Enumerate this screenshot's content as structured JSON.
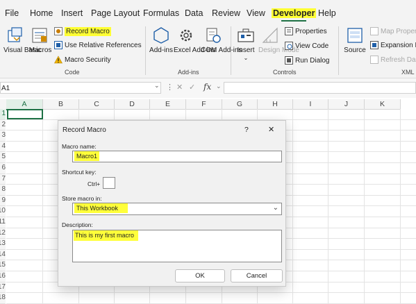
{
  "tabs": [
    {
      "label": "File"
    },
    {
      "label": "Home"
    },
    {
      "label": "Insert"
    },
    {
      "label": "Page Layout"
    },
    {
      "label": "Formulas"
    },
    {
      "label": "Data"
    },
    {
      "label": "Review"
    },
    {
      "label": "View"
    },
    {
      "label": "Developer",
      "active": true
    },
    {
      "label": "Help"
    }
  ],
  "ribbon": {
    "code": {
      "visual_basic": "Visual Basic",
      "macros": "Macros",
      "record_macro": "Record Macro",
      "relative_refs": "Use Relative References",
      "macro_security": "Macro Security",
      "group_label": "Code"
    },
    "addins": {
      "addins": "Add-ins",
      "excel_addins": "Excel Add-ins",
      "com_addins": "COM Add-ins",
      "group_label": "Add-ins"
    },
    "controls": {
      "insert": "Insert",
      "design_mode": "Design Mode",
      "properties": "Properties",
      "view_code": "View Code",
      "run_dialog": "Run Dialog",
      "group_label": "Controls"
    },
    "xml": {
      "source": "Source",
      "map_properties": "Map Proper",
      "expansion_packs": "Expansion P",
      "refresh_data": "Refresh Da",
      "group_label": "XML"
    }
  },
  "formula_bar": {
    "name_box": "A1",
    "fx": "fx",
    "formula": ""
  },
  "grid": {
    "columns": [
      "A",
      "B",
      "C",
      "D",
      "E",
      "F",
      "G",
      "H",
      "I",
      "J",
      "K"
    ],
    "rows": [
      "1",
      "2",
      "3",
      "4",
      "5",
      "6",
      "7",
      "8",
      "9",
      "10",
      "11",
      "12",
      "13",
      "14",
      "15",
      "16",
      "17",
      "18"
    ]
  },
  "dialog": {
    "title": "Record Macro",
    "help": "?",
    "close": "✕",
    "macro_name_label": "Macro name:",
    "macro_name_value": "Macro1",
    "shortcut_label": "Shortcut key:",
    "ctrl_label": "Ctrl+",
    "shortcut_value": "",
    "store_label": "Store macro in:",
    "store_value": "This Workbook",
    "description_label": "Description:",
    "description_value": "This is my first macro",
    "ok": "OK",
    "cancel": "Cancel"
  },
  "colors": {
    "highlight": "#ffff33",
    "excel_green": "#1e7145"
  }
}
